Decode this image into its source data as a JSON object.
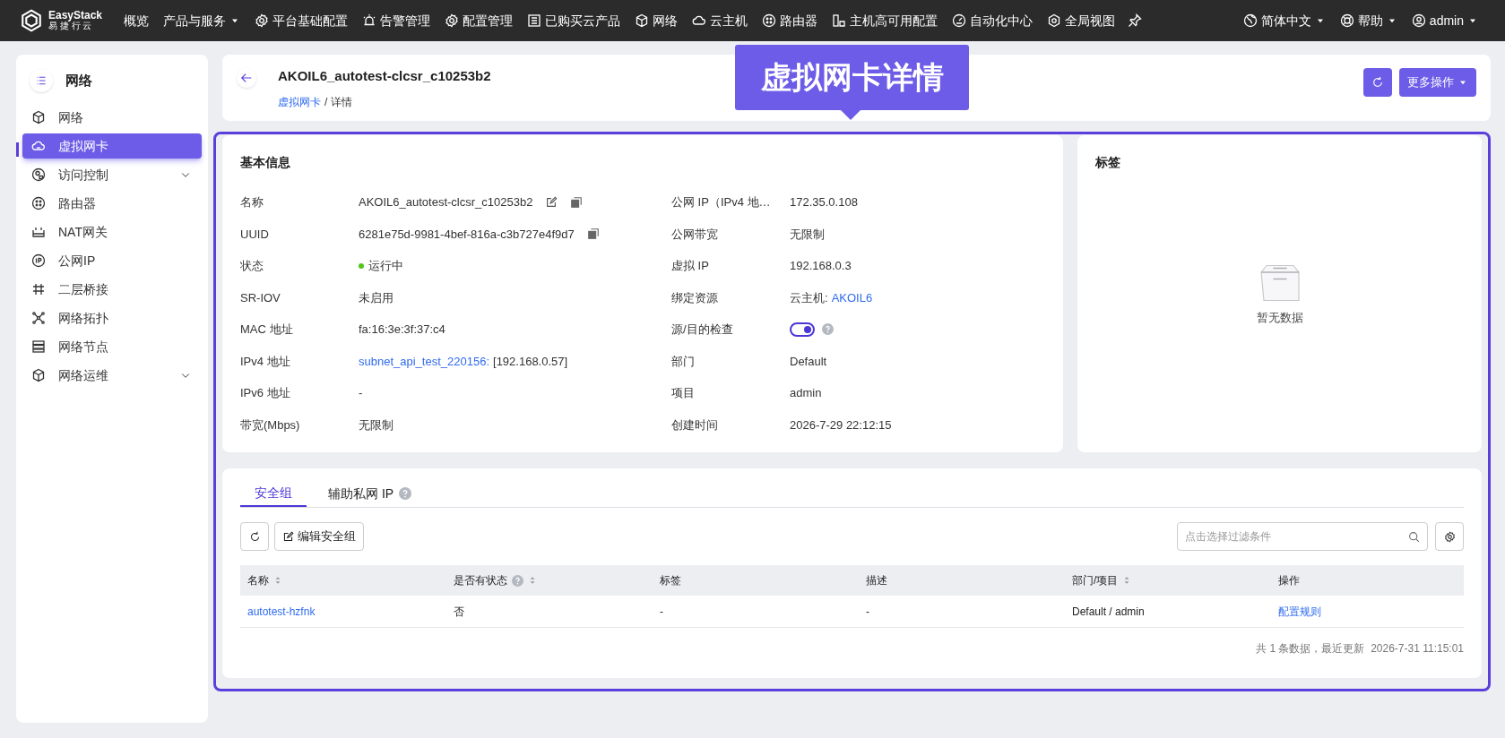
{
  "topbar": {
    "logo": {
      "name": "EasyStack",
      "subtitle": "易 捷 行 云"
    },
    "items": [
      {
        "label": "概览",
        "kind": "plain"
      },
      {
        "label": "产品与服务",
        "kind": "menu"
      },
      {
        "label": "平台基础配置",
        "kind": "icon"
      },
      {
        "label": "告警管理",
        "kind": "icon"
      },
      {
        "label": "配置管理",
        "kind": "icon"
      },
      {
        "label": "已购买云产品",
        "kind": "icon"
      },
      {
        "label": "网络",
        "kind": "icon"
      },
      {
        "label": "云主机",
        "kind": "icon"
      },
      {
        "label": "路由器",
        "kind": "icon"
      },
      {
        "label": "主机高可用配置",
        "kind": "icon"
      },
      {
        "label": "自动化中心",
        "kind": "icon"
      },
      {
        "label": "全局视图",
        "kind": "icon"
      }
    ],
    "right_items": [
      {
        "label": "简体中文"
      },
      {
        "label": "帮助"
      },
      {
        "label": "admin"
      }
    ]
  },
  "sidebar": {
    "title": "网络",
    "items": [
      {
        "label": "网络",
        "selected": false,
        "expandable": false
      },
      {
        "label": "虚拟网卡",
        "selected": true,
        "expandable": false
      },
      {
        "label": "访问控制",
        "selected": false,
        "expandable": true
      },
      {
        "label": "路由器",
        "selected": false,
        "expandable": false
      },
      {
        "label": "NAT网关",
        "selected": false,
        "expandable": false
      },
      {
        "label": "公网IP",
        "selected": false,
        "expandable": false
      },
      {
        "label": "二层桥接",
        "selected": false,
        "expandable": false
      },
      {
        "label": "网络拓扑",
        "selected": false,
        "expandable": false
      },
      {
        "label": "网络节点",
        "selected": false,
        "expandable": false
      },
      {
        "label": "网络运维",
        "selected": false,
        "expandable": true
      }
    ]
  },
  "header": {
    "title": "AKOIL6_autotest-clcsr_c10253b2",
    "breadcrumb": [
      {
        "label": "虚拟网卡",
        "link": true
      },
      {
        "label": "详情",
        "link": false
      }
    ],
    "breadcrumb_separator": "/",
    "more_button": "更多操作"
  },
  "callout": "虚拟网卡详情",
  "basic_info": {
    "title": "基本信息",
    "left": [
      {
        "label": "名称",
        "kind": "text",
        "value": "AKOIL6_autotest-clcsr_c10253b2",
        "editable": true,
        "copyable": true
      },
      {
        "label": "UUID",
        "kind": "text",
        "value": "6281e75d-9981-4bef-816a-c3b727e4f9d7",
        "editable": false,
        "copyable": true
      },
      {
        "label": "状态",
        "kind": "status",
        "value": "运行中",
        "color": "#52c41a"
      },
      {
        "label": "SR-IOV",
        "kind": "text",
        "value": "未启用"
      },
      {
        "label": "MAC 地址",
        "kind": "text",
        "value": "fa:16:3e:3f:37:c4"
      },
      {
        "label": "IPv4 地址",
        "kind": "parts",
        "parts": [
          {
            "text": "subnet_api_test_220156:",
            "link": true
          },
          {
            "text": "[192.168.0.57]",
            "link": false
          }
        ]
      },
      {
        "label": "IPv6 地址",
        "kind": "text",
        "value": "-"
      },
      {
        "label": "带宽(Mbps)",
        "kind": "text",
        "value": "无限制"
      }
    ],
    "right": [
      {
        "label": "公网 IP（IPv4 地…",
        "kind": "text",
        "value": "172.35.0.108"
      },
      {
        "label": "公网带宽",
        "kind": "text",
        "value": "无限制"
      },
      {
        "label": "虚拟 IP",
        "kind": "text",
        "value": "192.168.0.3"
      },
      {
        "label": "绑定资源",
        "kind": "parts",
        "parts": [
          {
            "text": "云主机:",
            "link": false
          },
          {
            "text": "AKOIL6",
            "link": true
          }
        ]
      },
      {
        "label": "源/目的检查",
        "kind": "toggle",
        "checked": true
      },
      {
        "label": "部门",
        "kind": "text",
        "value": "Default"
      },
      {
        "label": "项目",
        "kind": "text",
        "value": "admin"
      },
      {
        "label": "创建时间",
        "kind": "text",
        "value": "2026-7-29 22:12:15"
      }
    ]
  },
  "tags_card": {
    "title": "标签",
    "empty_text": "暂无数据"
  },
  "tabs": [
    {
      "label": "安全组",
      "selected": true,
      "help": false
    },
    {
      "label": "辅助私网 IP",
      "selected": false,
      "help": true
    }
  ],
  "toolbar": {
    "edit_button": "编辑安全组",
    "search_placeholder": "点击选择过滤条件"
  },
  "table": {
    "columns": [
      {
        "label": "名称",
        "sortable": true,
        "help": false
      },
      {
        "label": "是否有状态",
        "sortable": true,
        "help": true
      },
      {
        "label": "标签",
        "sortable": false,
        "help": false
      },
      {
        "label": "描述",
        "sortable": false,
        "help": false
      },
      {
        "label": "部门/项目",
        "sortable": true,
        "help": false
      },
      {
        "label": "操作",
        "sortable": false,
        "help": false
      }
    ],
    "rows": [
      [
        {
          "text": "autotest-hzfnk",
          "link": true
        },
        {
          "text": "否",
          "link": false
        },
        {
          "text": "-",
          "link": false
        },
        {
          "text": "-",
          "link": false
        },
        {
          "text": "Default / admin",
          "link": false
        },
        {
          "text": "配置规则",
          "link": true
        }
      ]
    ],
    "footer": "共 1 条数据，最近更新  2026-7-31 11:15:01"
  }
}
